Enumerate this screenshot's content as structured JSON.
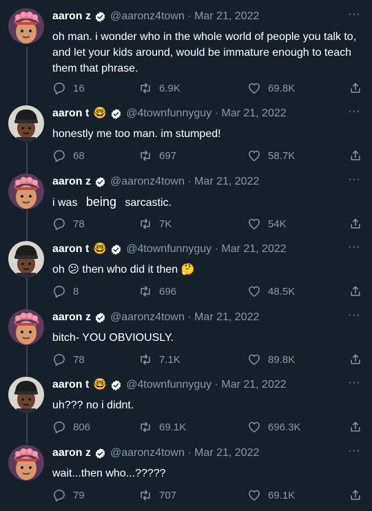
{
  "colors": {
    "background": "#15202b",
    "text": "#ffffff",
    "muted": "#8b98a5",
    "verified": "#1d9bf0"
  },
  "tweets": [
    {
      "name": "aaron z",
      "handle": "@aaronz4town · Mar 21, 2022",
      "avatar": "pink-hair-character",
      "text": "oh man. i wonder who in the whole world of people you talk to, and let your kids around, would be immature enough to teach them that phrase.",
      "replies": "16",
      "retweets": "6.9K",
      "likes": "69.8K"
    },
    {
      "name": "aaron t",
      "name_emoji": "🤓",
      "handle": "@4townfunnyguy · Mar 21, 2022",
      "avatar": "beanie-character",
      "text": "honestly me too man. im stumped!",
      "replies": "68",
      "retweets": "697",
      "likes": "58.7K"
    },
    {
      "name": "aaron z",
      "handle": "@aaronz4town · Mar 21, 2022",
      "avatar": "pink-hair-character",
      "text_parts": [
        "i was",
        "being",
        "sarcastic."
      ],
      "replies": "78",
      "retweets": "7K",
      "likes": "54K"
    },
    {
      "name": "aaron t",
      "name_emoji": "🤓",
      "handle": "@4townfunnyguy · Mar 21, 2022",
      "avatar": "beanie-character",
      "text_parts": [
        "oh",
        "😕",
        "then who did it then",
        "🤔"
      ],
      "replies": "8",
      "retweets": "696",
      "likes": "48.5K"
    },
    {
      "name": "aaron z",
      "handle": "@aaronz4town · Mar 21, 2022",
      "avatar": "pink-hair-character",
      "text": "bitch- YOU OBVIOUSLY.",
      "replies": "78",
      "retweets": "7.1K",
      "likes": "89.8K"
    },
    {
      "name": "aaron t",
      "name_emoji": "🤓",
      "handle": "@4townfunnyguy · Mar 21, 2022",
      "avatar": "beanie-character",
      "text": "uh??? no i didnt.",
      "replies": "806",
      "retweets": "69.1K",
      "likes": "696.3K"
    },
    {
      "name": "aaron z",
      "handle": "@aaronz4town · Mar 21, 2022",
      "avatar": "pink-hair-character",
      "text": "wait...then who...?????",
      "replies": "79",
      "retweets": "707",
      "likes": "69.1K"
    }
  ],
  "more_label": "···"
}
